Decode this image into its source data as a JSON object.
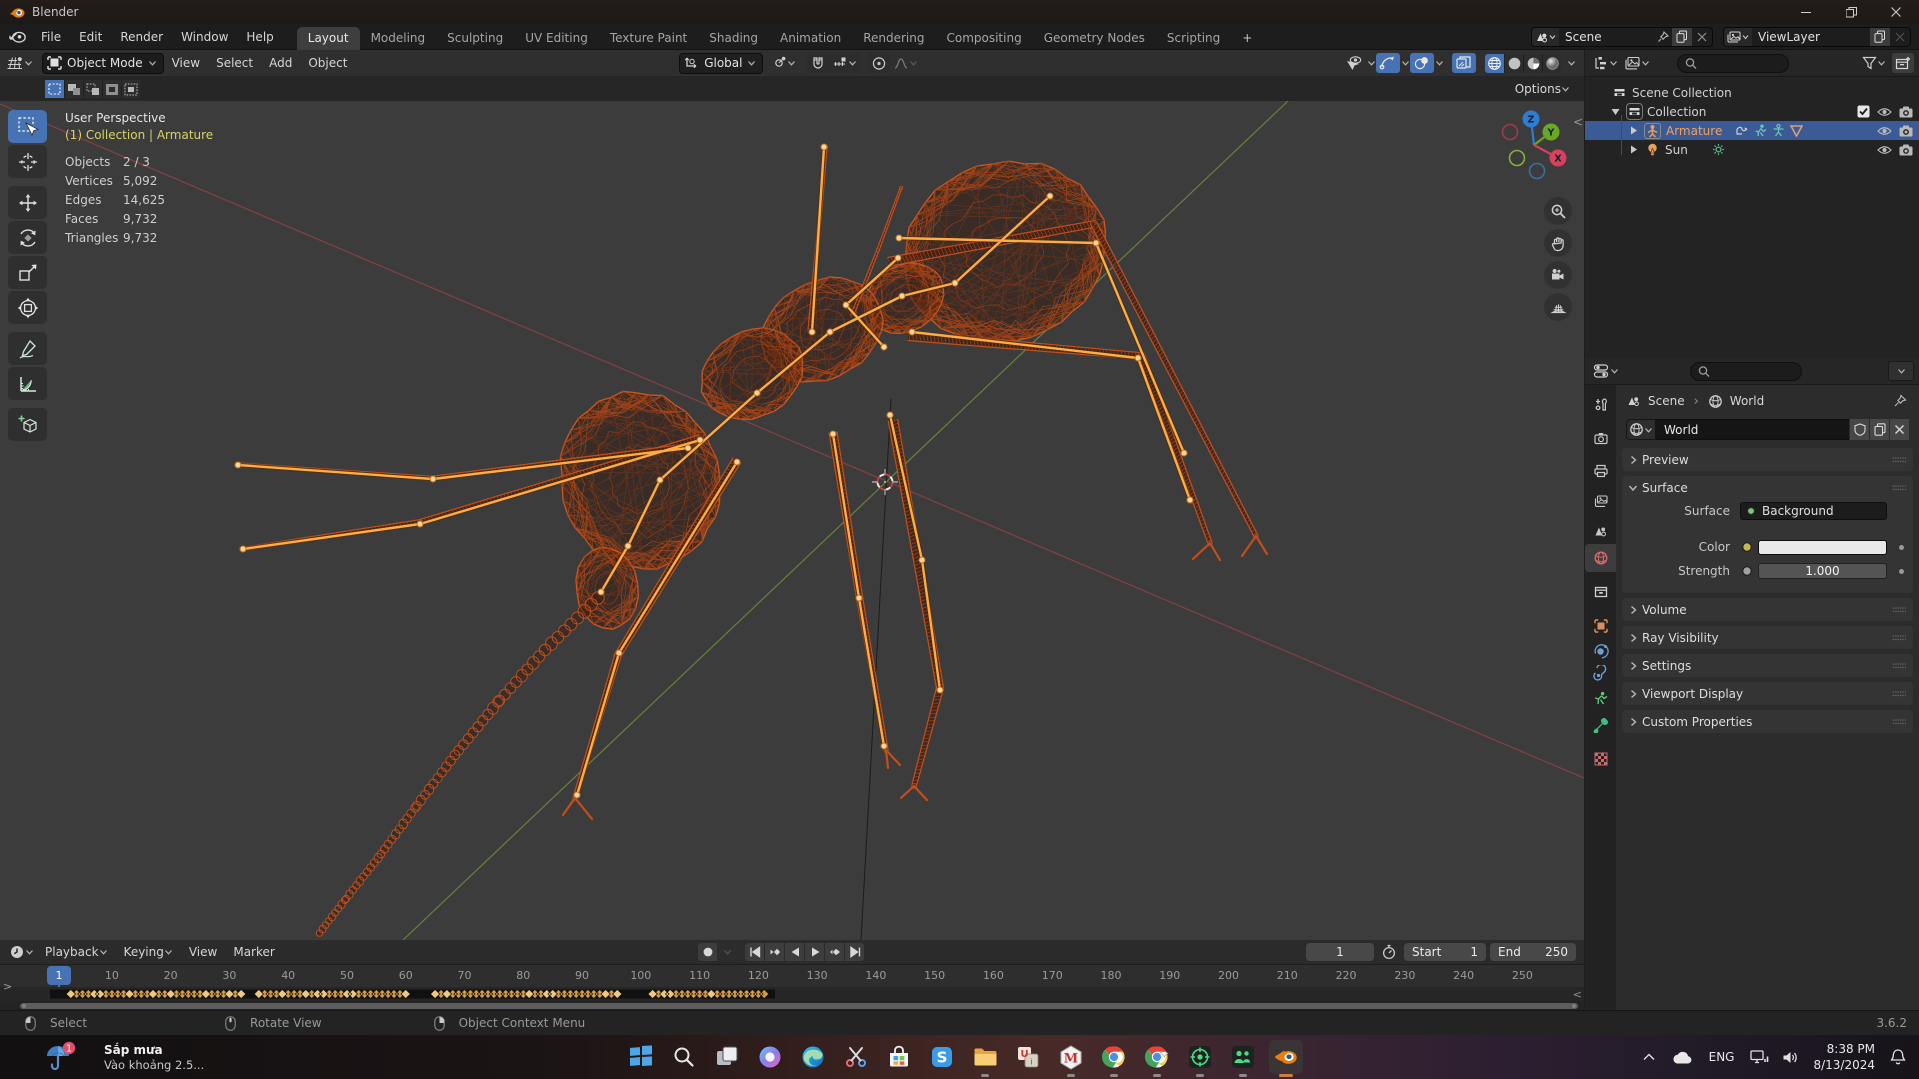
{
  "window": {
    "title": "Blender",
    "controls": [
      "minimize",
      "maximize",
      "close"
    ]
  },
  "topbar": {
    "menus": [
      "File",
      "Edit",
      "Render",
      "Window",
      "Help"
    ],
    "workspaces": [
      "Layout",
      "Modeling",
      "Sculpting",
      "UV Editing",
      "Texture Paint",
      "Shading",
      "Animation",
      "Rendering",
      "Compositing",
      "Geometry Nodes",
      "Scripting"
    ],
    "active_workspace": "Layout",
    "new_workspace_label": "+",
    "scene_selector": {
      "value": "Scene"
    },
    "viewlayer_selector": {
      "value": "ViewLayer"
    }
  },
  "viewport": {
    "header": {
      "mode": "Object Mode",
      "menus": [
        "View",
        "Select",
        "Add",
        "Object"
      ],
      "orientation": "Global",
      "options_label": "Options"
    },
    "overlay": {
      "perspective": "User Perspective",
      "context": "(1) Collection | Armature",
      "stats": [
        {
          "label": "Objects",
          "value": "2 / 3"
        },
        {
          "label": "Vertices",
          "value": "5,092"
        },
        {
          "label": "Edges",
          "value": "14,625"
        },
        {
          "label": "Faces",
          "value": "9,732"
        },
        {
          "label": "Triangles",
          "value": "9,732"
        }
      ]
    },
    "toolbar": [
      "select-box",
      "cursor",
      "move",
      "rotate",
      "scale",
      "transform",
      "annotate",
      "measure",
      "add-cube"
    ],
    "gizmo_axes": [
      "Z",
      "Y",
      "X"
    ],
    "nav_buttons": [
      "zoom",
      "pan",
      "camera-view",
      "toggle-projection"
    ]
  },
  "outliner": {
    "rows": [
      {
        "label": "Scene Collection",
        "icon": "collection",
        "depth": 0
      },
      {
        "label": "Collection",
        "icon": "collection",
        "depth": 1,
        "toggles": [
          "checkbox",
          "eye",
          "camera"
        ]
      },
      {
        "label": "Armature",
        "icon": "armature",
        "depth": 2,
        "selected": true,
        "data_icons": [
          "animation",
          "pose",
          "armature-data",
          "mesh"
        ],
        "toggles": [
          "eye",
          "camera"
        ]
      },
      {
        "label": "Sun",
        "icon": "light",
        "depth": 2,
        "data_icons": [
          "sun-data"
        ],
        "toggles": [
          "eye",
          "camera"
        ]
      }
    ]
  },
  "properties": {
    "breadcrumb": {
      "items": [
        "Scene",
        "World"
      ]
    },
    "id_block": {
      "name": "World"
    },
    "tabs": [
      "tool",
      "render",
      "output",
      "view-layer",
      "scene",
      "world",
      "collection",
      "object",
      "physics",
      "constraints",
      "data",
      "bone",
      "texture"
    ],
    "active_tab": "world",
    "panels": [
      {
        "label": "Preview",
        "expanded": false
      },
      {
        "label": "Surface",
        "expanded": true
      },
      {
        "label": "Volume",
        "expanded": false
      },
      {
        "label": "Ray Visibility",
        "expanded": false
      },
      {
        "label": "Settings",
        "expanded": false
      },
      {
        "label": "Viewport Display",
        "expanded": false
      },
      {
        "label": "Custom Properties",
        "expanded": false
      }
    ],
    "surface": {
      "surface_label": "Surface",
      "surface_value": "Background",
      "color_label": "Color",
      "strength_label": "Strength",
      "strength_value": "1.000"
    }
  },
  "timeline": {
    "menus": [
      "Playback",
      "Keying",
      "View",
      "Marker"
    ],
    "transport": [
      "jump-to-start",
      "jump-to-prev-keyframe",
      "play-reverse",
      "play",
      "jump-to-next-keyframe",
      "jump-to-end"
    ],
    "current_frame": "1",
    "start": {
      "label": "Start",
      "value": "1"
    },
    "end": {
      "label": "End",
      "value": "250"
    },
    "ruler_ticks": [
      10,
      20,
      30,
      40,
      50,
      60,
      70,
      80,
      90,
      100,
      110,
      120,
      130,
      140,
      150,
      160,
      170,
      180,
      190,
      200,
      210,
      220,
      230,
      240,
      250
    ],
    "playhead_frame": "1"
  },
  "statusbar": {
    "hints": [
      {
        "button": "left-mouse",
        "label": "Select"
      },
      {
        "button": "middle-mouse",
        "label": "Rotate View"
      },
      {
        "button": "right-mouse",
        "label": "Object Context Menu"
      }
    ],
    "version": "3.6.2"
  },
  "taskbar": {
    "weather": {
      "badge": "1",
      "line1": "Sắp mưa",
      "line2": "Vào khoảng 2.5..."
    },
    "icons": [
      "start",
      "search",
      "task-view",
      "copilot",
      "edge",
      "snipping",
      "store",
      "skype",
      "explorer",
      "unikey",
      "mathtype",
      "chrome",
      "chrome-alt",
      "obs",
      "teams",
      "blender"
    ],
    "tray": {
      "chevron": "^",
      "language": "ENG",
      "time": "8:38 PM",
      "date": "8/13/2024"
    }
  },
  "colors": {
    "accent_blue": "#4772b3",
    "selected_wire": "#e1662e",
    "bone": "#ffac43",
    "active_text": "#f0a35e",
    "context_text": "#d8d265"
  }
}
